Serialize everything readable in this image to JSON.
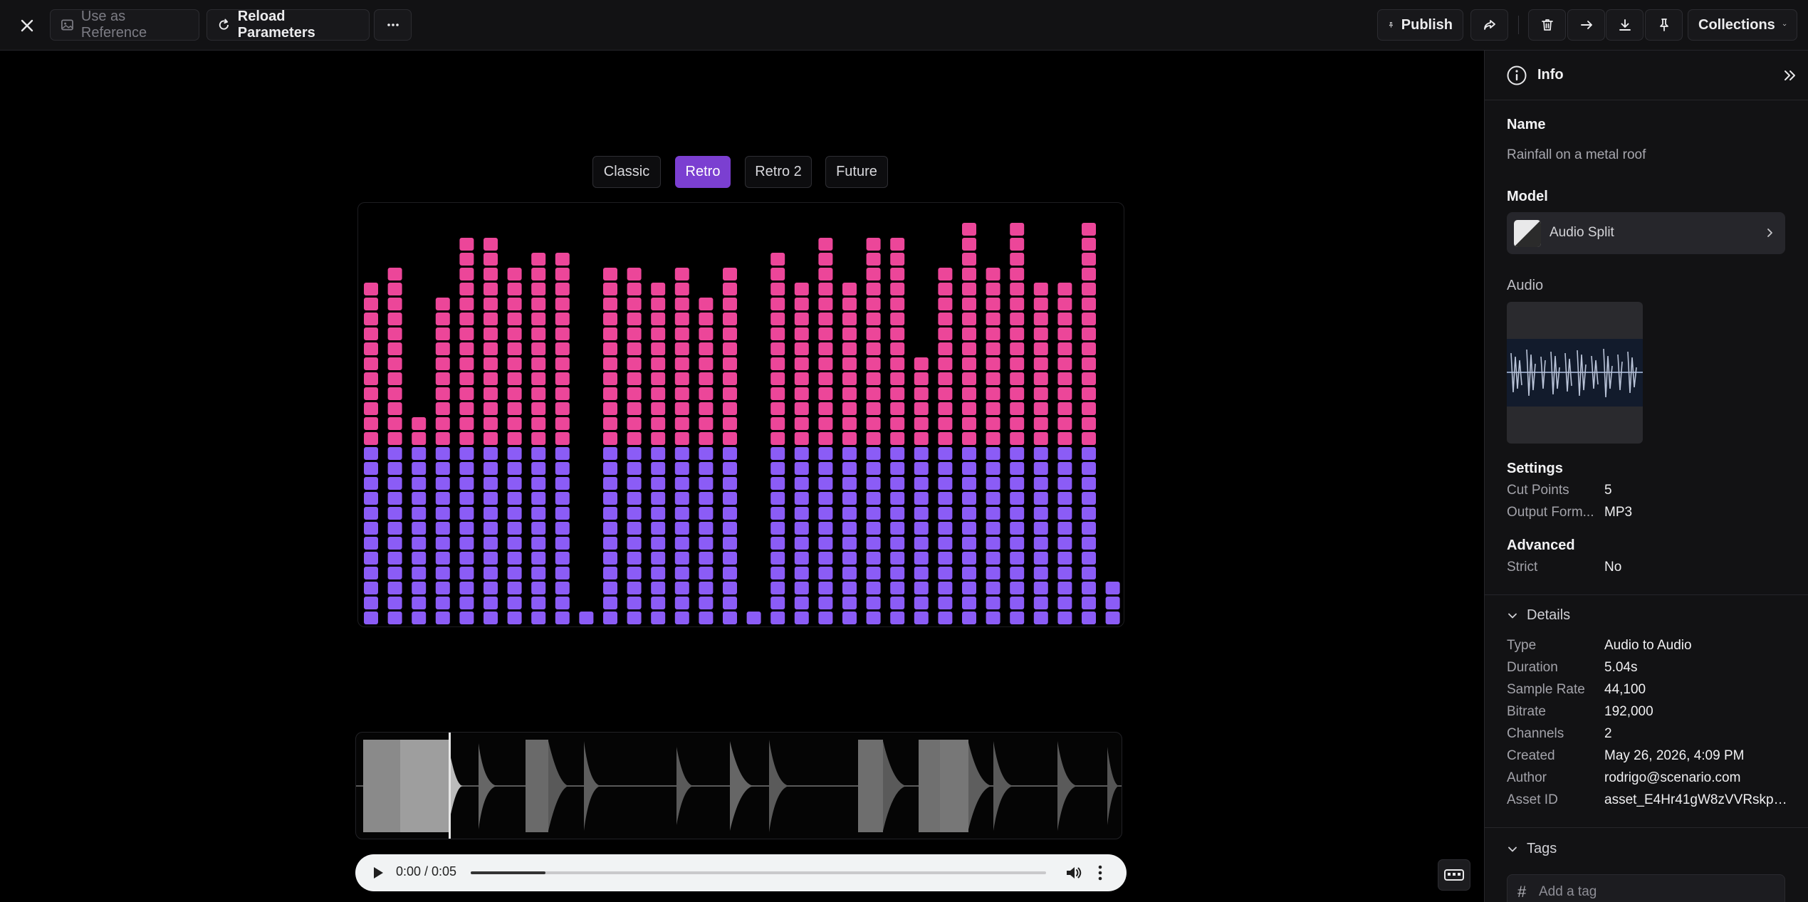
{
  "toolbar": {
    "use_as_reference": "Use as Reference",
    "reload_parameters": "Reload Parameters",
    "publish": "Publish",
    "collections": "Collections",
    "icons": {
      "close": "close-icon",
      "reference": "image-icon",
      "reload": "reload-icon",
      "more": "more-horizontal-icon",
      "publish": "pin-icon",
      "share": "share-icon",
      "delete": "trash-icon",
      "move": "arrow-right-icon",
      "download": "download-icon",
      "pin": "pin-icon",
      "collections_dropdown": "chevron-down-icon"
    }
  },
  "presets": {
    "tabs": [
      "Classic",
      "Retro",
      "Retro 2",
      "Future"
    ],
    "active": "Retro"
  },
  "visualizer": {
    "colors": {
      "top": "#ec4699",
      "bottom": "#8b5cf6"
    },
    "levels": [
      23,
      24,
      14,
      22,
      26,
      26,
      24,
      25,
      25,
      1,
      24,
      24,
      23,
      24,
      22,
      24,
      1,
      25,
      23,
      26,
      23,
      26,
      26,
      18,
      24,
      27,
      24,
      27,
      23,
      23,
      27,
      3
    ],
    "split_row": 12
  },
  "player": {
    "time": "0:00 / 0:05",
    "progress": 0.13
  },
  "panel": {
    "title": "Info",
    "name_label": "Name",
    "name_value": "Rainfall on a metal roof",
    "model_label": "Model",
    "model_name": "Audio Split",
    "audio_label": "Audio",
    "settings_label": "Settings",
    "settings": [
      {
        "key": "Cut Points",
        "value": "5"
      },
      {
        "key": "Output Form...",
        "value": "MP3"
      }
    ],
    "advanced_label": "Advanced",
    "advanced": [
      {
        "key": "Strict",
        "value": "No"
      }
    ],
    "details_label": "Details",
    "details": [
      {
        "key": "Type",
        "value": "Audio to Audio"
      },
      {
        "key": "Duration",
        "value": "5.04s"
      },
      {
        "key": "Sample Rate",
        "value": "44,100"
      },
      {
        "key": "Bitrate",
        "value": "192,000"
      },
      {
        "key": "Channels",
        "value": "2"
      },
      {
        "key": "Created",
        "value": "May 26, 2026, 4:09 PM"
      },
      {
        "key": "Author",
        "value": "rodrigo@scenario.com"
      },
      {
        "key": "Asset ID",
        "value": "asset_E4Hr41gW8zVVRskpH..."
      }
    ],
    "tags_label": "Tags",
    "tag_placeholder": "Add a tag",
    "tag_prefix": "#"
  }
}
